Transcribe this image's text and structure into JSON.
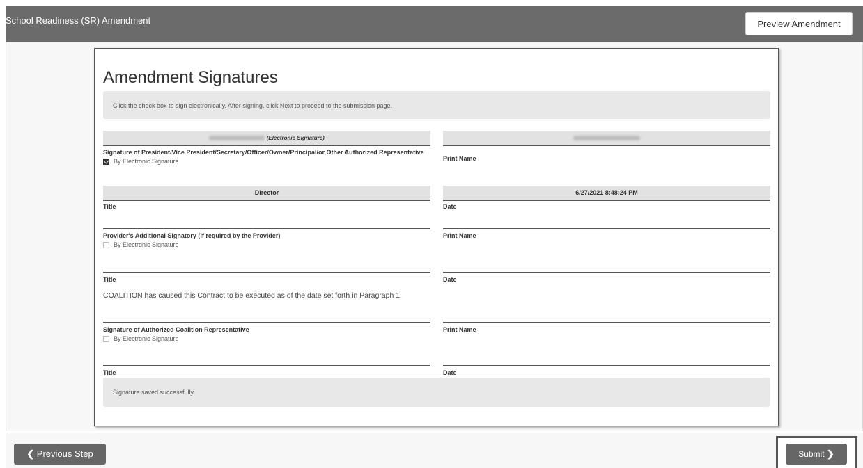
{
  "window": {
    "title": "School Readiness (SR) Amendment"
  },
  "header": {
    "preview_label": "Preview Amendment"
  },
  "card": {
    "heading": "Amendment Signatures",
    "instructions": "Click the check box to sign electronically. After signing, click Next to proceed to the submission page.",
    "sig1": {
      "signature_suffix": "(Electronic Signature)",
      "signature_label": "Signature of President/Vice President/Secretary/Officer/Owner/Principal/or Other Authorized Representative",
      "checkbox_label": "By Electronic Signature",
      "checked": true,
      "print_name_label": "Print Name",
      "title_value": "Director",
      "title_label": "Title",
      "date_value": "6/27/2021 8:48:24 PM",
      "date_label": "Date"
    },
    "sig2": {
      "signature_label": "Provider's Additional Signatory (If required by the Provider)",
      "checkbox_label": "By Electronic Signature",
      "print_name_label": "Print Name",
      "title_label": "Title",
      "date_label": "Date"
    },
    "coalition_text": "COALITION has caused this Contract to be executed as of the date set forth in Paragraph 1.",
    "sig3": {
      "signature_label": "Signature of Authorized Coalition Representative",
      "checkbox_label": "By Electronic Signature",
      "print_name_label": "Print Name",
      "title_label": "Title",
      "date_label": "Date"
    },
    "status_message": "Signature saved successfully."
  },
  "footer": {
    "previous_label": "Previous Step",
    "submit_label": "Submit"
  },
  "icons": {
    "previous": "chevron-left-icon",
    "submit": "chevron-right-icon"
  }
}
